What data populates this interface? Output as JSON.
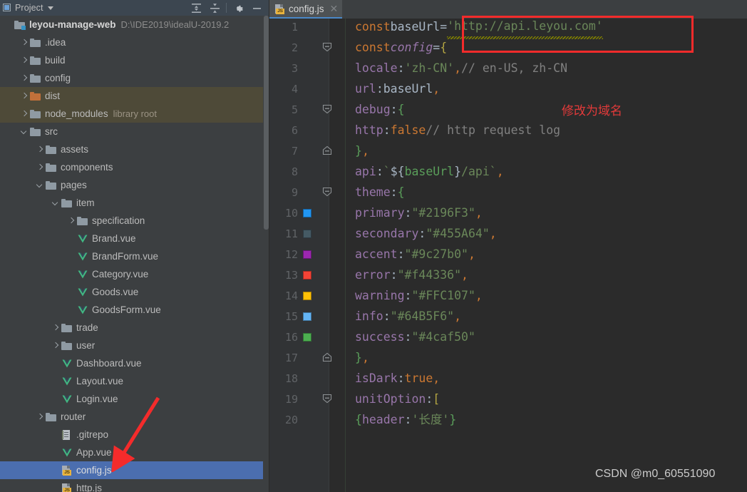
{
  "panel": {
    "title": "Project",
    "caret_icon": "chevron-down-icon",
    "tools": [
      {
        "name": "expand-all-icon",
        "label": "Expand All"
      },
      {
        "name": "collapse-all-icon",
        "label": "Collapse All"
      },
      {
        "name": "gear-icon",
        "label": "Settings"
      },
      {
        "name": "minimize-icon",
        "label": "Hide"
      }
    ]
  },
  "tree": [
    {
      "label": "leyou-manage-web",
      "suffix": "D:\\IDE2019\\idealU-2019.2",
      "icon": "module-icon",
      "indent": 0,
      "arrow": "none",
      "style": "root"
    },
    {
      "label": ".idea",
      "suffix": "",
      "icon": "folder-icon",
      "indent": 1,
      "arrow": "right",
      "style": "normal"
    },
    {
      "label": "build",
      "suffix": "",
      "icon": "folder-icon",
      "indent": 1,
      "arrow": "right",
      "style": "normal"
    },
    {
      "label": "config",
      "suffix": "",
      "icon": "folder-icon",
      "indent": 1,
      "arrow": "right",
      "style": "normal"
    },
    {
      "label": "dist",
      "suffix": "",
      "icon": "folder-orange-icon",
      "indent": 1,
      "arrow": "right",
      "style": "excluded"
    },
    {
      "label": "node_modules",
      "suffix": "library root",
      "icon": "folder-icon",
      "indent": 1,
      "arrow": "right",
      "style": "excluded"
    },
    {
      "label": "src",
      "suffix": "",
      "icon": "folder-icon",
      "indent": 1,
      "arrow": "down",
      "style": "normal"
    },
    {
      "label": "assets",
      "suffix": "",
      "icon": "folder-icon",
      "indent": 2,
      "arrow": "right",
      "style": "normal"
    },
    {
      "label": "components",
      "suffix": "",
      "icon": "folder-icon",
      "indent": 2,
      "arrow": "right",
      "style": "normal"
    },
    {
      "label": "pages",
      "suffix": "",
      "icon": "folder-icon",
      "indent": 2,
      "arrow": "down",
      "style": "normal"
    },
    {
      "label": "item",
      "suffix": "",
      "icon": "folder-icon",
      "indent": 3,
      "arrow": "down",
      "style": "normal"
    },
    {
      "label": "specification",
      "suffix": "",
      "icon": "folder-icon",
      "indent": 4,
      "arrow": "right",
      "style": "normal"
    },
    {
      "label": "Brand.vue",
      "suffix": "",
      "icon": "vue-icon",
      "indent": 4,
      "arrow": "none",
      "style": "normal"
    },
    {
      "label": "BrandForm.vue",
      "suffix": "",
      "icon": "vue-icon",
      "indent": 4,
      "arrow": "none",
      "style": "normal"
    },
    {
      "label": "Category.vue",
      "suffix": "",
      "icon": "vue-icon",
      "indent": 4,
      "arrow": "none",
      "style": "normal"
    },
    {
      "label": "Goods.vue",
      "suffix": "",
      "icon": "vue-icon",
      "indent": 4,
      "arrow": "none",
      "style": "normal"
    },
    {
      "label": "GoodsForm.vue",
      "suffix": "",
      "icon": "vue-icon",
      "indent": 4,
      "arrow": "none",
      "style": "normal"
    },
    {
      "label": "trade",
      "suffix": "",
      "icon": "folder-icon",
      "indent": 3,
      "arrow": "right",
      "style": "normal"
    },
    {
      "label": "user",
      "suffix": "",
      "icon": "folder-icon",
      "indent": 3,
      "arrow": "right",
      "style": "normal"
    },
    {
      "label": "Dashboard.vue",
      "suffix": "",
      "icon": "vue-icon",
      "indent": 3,
      "arrow": "none",
      "style": "normal"
    },
    {
      "label": "Layout.vue",
      "suffix": "",
      "icon": "vue-icon",
      "indent": 3,
      "arrow": "none",
      "style": "normal"
    },
    {
      "label": "Login.vue",
      "suffix": "",
      "icon": "vue-icon",
      "indent": 3,
      "arrow": "none",
      "style": "normal"
    },
    {
      "label": "router",
      "suffix": "",
      "icon": "folder-icon",
      "indent": 2,
      "arrow": "right",
      "style": "normal"
    },
    {
      "label": ".gitrepo",
      "suffix": "",
      "icon": "text-file-icon",
      "indent": 3,
      "arrow": "none",
      "style": "normal"
    },
    {
      "label": "App.vue",
      "suffix": "",
      "icon": "vue-icon",
      "indent": 3,
      "arrow": "none",
      "style": "normal"
    },
    {
      "label": "config.js",
      "suffix": "",
      "icon": "js-file-icon",
      "indent": 3,
      "arrow": "none",
      "style": "selected"
    },
    {
      "label": "http.js",
      "suffix": "",
      "icon": "js-file-icon",
      "indent": 3,
      "arrow": "none",
      "style": "normal"
    }
  ],
  "editor": {
    "tab": {
      "label": "config.js",
      "icon": "js-file-icon",
      "close_icon": "close-icon"
    },
    "lines": [
      {
        "n": "1",
        "fold": "none",
        "swatch": null,
        "html": "<span class='kw'>const</span> <span class='var'>baseUrl</span> <span class='op'>=</span> <span class='str squig'>'http://api.leyou.com'</span>"
      },
      {
        "n": "2",
        "fold": "open",
        "swatch": null,
        "html": "<span class='kw'>const</span> <span class='cls'>config</span> <span class='op'>=</span> <span class='brace-y'>{</span>"
      },
      {
        "n": "3",
        "fold": "none",
        "swatch": null,
        "html": "  <span class='prop'>locale</span><span class='op'>:</span> <span class='str'>'zh-CN'</span><span class='punc'>,</span> <span class='cmt'>// en-US, zh-CN</span>"
      },
      {
        "n": "4",
        "fold": "none",
        "swatch": null,
        "html": "  <span class='prop'>url</span><span class='op'>:</span> <span class='var'>baseUrl</span><span class='punc'>,</span>"
      },
      {
        "n": "5",
        "fold": "open",
        "swatch": null,
        "html": "  <span class='prop'>debug</span><span class='op'>:</span> <span class='brace-g'>{</span>"
      },
      {
        "n": "6",
        "fold": "none",
        "swatch": null,
        "html": "    <span class='prop'>http</span><span class='op'>:</span> <span class='bool'>false</span> <span class='cmt'>// http request log</span>"
      },
      {
        "n": "7",
        "fold": "close",
        "swatch": null,
        "html": "  <span class='brace-g'>}</span><span class='punc'>,</span>"
      },
      {
        "n": "8",
        "fold": "none",
        "swatch": null,
        "html": "  <span class='prop'>api</span><span class='op'>:</span> <span class='tmpl'>`</span><span class='tmplv'>${</span><span class='brace-g'>baseUrl</span><span class='tmplv'>}</span><span class='tmpl'>/api`</span><span class='punc'>,</span>"
      },
      {
        "n": "9",
        "fold": "open",
        "swatch": null,
        "html": "  <span class='prop'>theme</span><span class='op'>:</span><span class='brace-g'>{</span>"
      },
      {
        "n": "10",
        "fold": "none",
        "swatch": "#2196F3",
        "html": "    <span class='prop'>primary</span><span class='op'>:</span> <span class='str'>\"#2196F3\"</span><span class='punc'>,</span>"
      },
      {
        "n": "11",
        "fold": "none",
        "swatch": "#455A64",
        "html": "    <span class='prop'>secondary</span><span class='op'>:</span> <span class='str'>\"#455A64\"</span><span class='punc'>,</span>"
      },
      {
        "n": "12",
        "fold": "none",
        "swatch": "#9c27b0",
        "html": "    <span class='prop'>accent</span><span class='op'>:</span> <span class='str'>\"#9c27b0\"</span><span class='punc'>,</span>"
      },
      {
        "n": "13",
        "fold": "none",
        "swatch": "#f44336",
        "html": "    <span class='prop'>error</span><span class='op'>:</span> <span class='str'>\"#f44336\"</span><span class='punc'>,</span>"
      },
      {
        "n": "14",
        "fold": "none",
        "swatch": "#FFC107",
        "html": "    <span class='prop'>warning</span><span class='op'>:</span> <span class='str'>\"#FFC107\"</span><span class='punc'>,</span>"
      },
      {
        "n": "15",
        "fold": "none",
        "swatch": "#64B5F6",
        "html": "    <span class='prop'>info</span><span class='op'>:</span> <span class='str'>\"#64B5F6\"</span><span class='punc'>,</span>"
      },
      {
        "n": "16",
        "fold": "none",
        "swatch": "#4caf50",
        "html": "    <span class='prop'>success</span><span class='op'>:</span> <span class='str'>\"#4caf50\"</span>"
      },
      {
        "n": "17",
        "fold": "close",
        "swatch": null,
        "html": "  <span class='brace-g'>}</span><span class='punc'>,</span>"
      },
      {
        "n": "18",
        "fold": "none",
        "swatch": null,
        "html": "  <span class='prop'>isDark</span><span class='op'>:</span><span class='bool'>true</span><span class='punc'>,</span>"
      },
      {
        "n": "19",
        "fold": "open",
        "swatch": null,
        "html": "  <span class='prop'>unitOption</span><span class='op'>:</span><span class='brace-y'>[</span>"
      },
      {
        "n": "20",
        "fold": "none",
        "swatch": null,
        "html": "    <span class='brace-g'>{</span> <span class='prop'>header</span><span class='op'>:</span> <span class='str'>'长度'</span> <span class='brace-g'>}</span>"
      }
    ],
    "code_text": {
      "line1_url": "'http://api.leyou.com'",
      "line20_header_value": "'长度'"
    }
  },
  "annotations": {
    "red_box_target": "'http://api.leyou.com'",
    "chinese_note": "修改为域名",
    "arrow_target": "config.js",
    "watermark": "CSDN @m0_60551090",
    "red_color": "#f42b2b"
  }
}
